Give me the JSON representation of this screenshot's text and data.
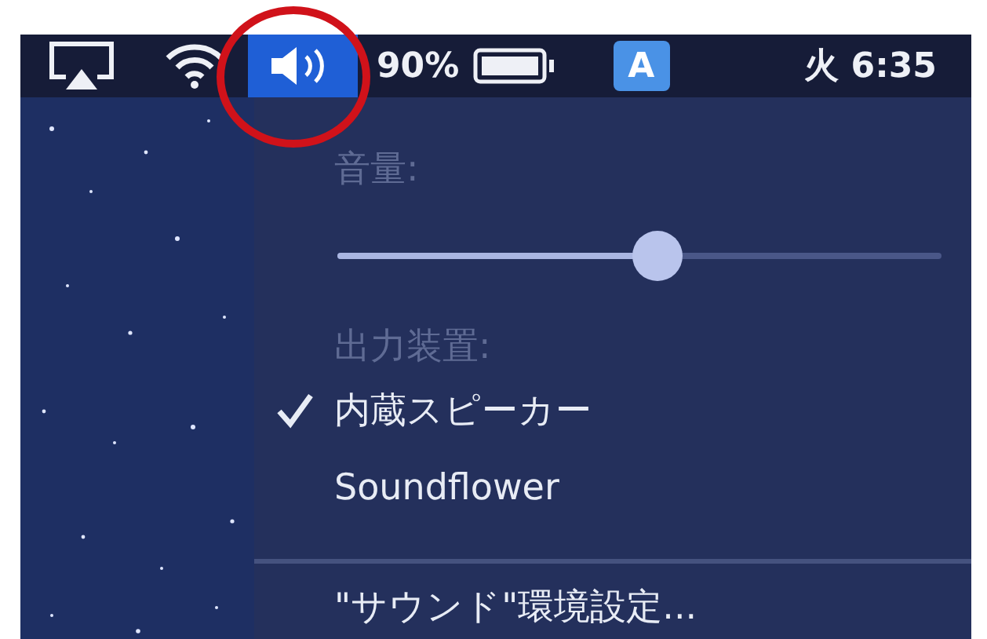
{
  "menu_bar": {
    "sound_selected": true,
    "battery": "90%",
    "input_source": "A",
    "clock": "火 6:35"
  },
  "sound_menu": {
    "volume_label": "音量:",
    "volume": {
      "level": 0.53
    },
    "output_label": "出力装置:",
    "devices": [
      {
        "name": "内蔵スピーカー",
        "selected": true
      },
      {
        "name": "Soundflower",
        "selected": false
      }
    ],
    "preferences": "\"サウンド\"環境設定..."
  }
}
